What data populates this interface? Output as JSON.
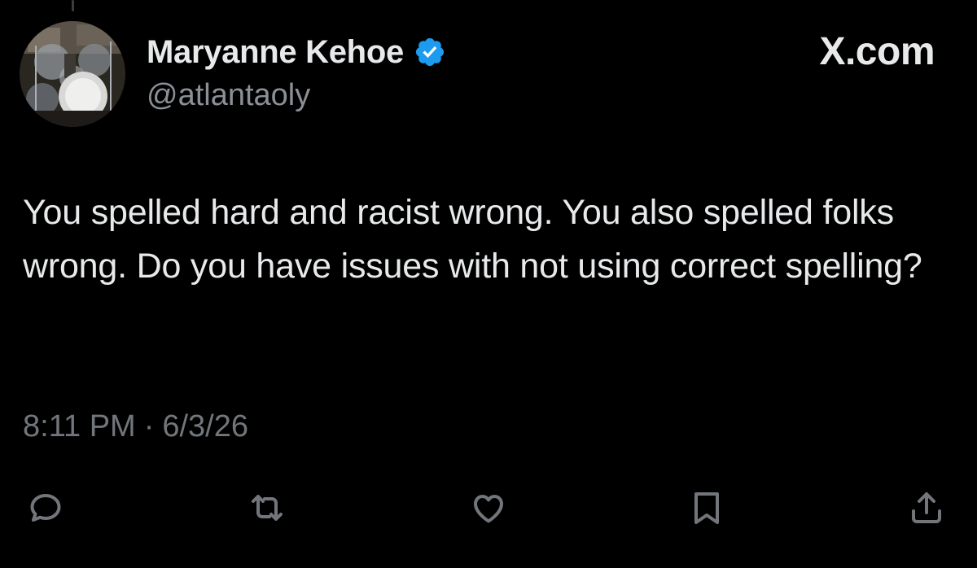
{
  "author": {
    "display_name": "Maryanne Kehoe",
    "handle": "@atlantaoly",
    "verified": true,
    "verified_color": "#1d9bf0"
  },
  "brand": {
    "label": "X.com"
  },
  "post": {
    "text": "You spelled hard and racist wrong. You also spelled folks wrong. Do you have issues with not using correct spelling?",
    "time": "8:11 PM",
    "separator": "·",
    "date": "6/3/26"
  },
  "actions": [
    {
      "icon": "reply-icon"
    },
    {
      "icon": "repost-icon"
    },
    {
      "icon": "like-icon"
    },
    {
      "icon": "bookmark-icon"
    },
    {
      "icon": "share-icon"
    }
  ],
  "colors": {
    "background": "#000000",
    "primary_text": "#e7e9ea",
    "secondary_text": "#8b9096",
    "icon": "#72767b"
  }
}
